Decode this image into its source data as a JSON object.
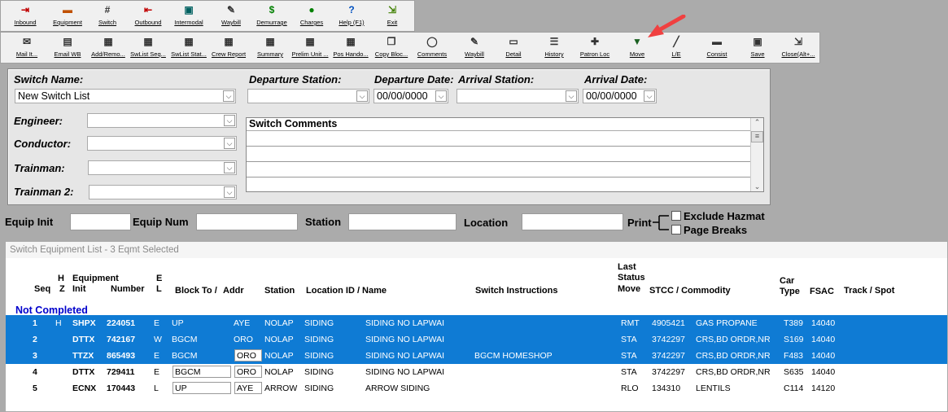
{
  "toolbar1": [
    {
      "label": "Inbound",
      "icon": "inbound-icon",
      "color": "#c00000"
    },
    {
      "label": "Equipment",
      "icon": "railcar-icon",
      "color": "#c05000"
    },
    {
      "label": "Switch",
      "icon": "switch-track-icon",
      "color": "#333333"
    },
    {
      "label": "Outbound",
      "icon": "outbound-icon",
      "color": "#c00000"
    },
    {
      "label": "Intermodal",
      "icon": "intermodal-icon",
      "color": "#006060"
    },
    {
      "label": "Waybill",
      "icon": "waybill-icon",
      "color": "#333333"
    },
    {
      "label": "Demurrage",
      "icon": "dollar-icon",
      "color": "#008000"
    },
    {
      "label": "Charges",
      "icon": "money-bag-icon",
      "color": "#008000"
    },
    {
      "label": "Help (F1)",
      "icon": "help-icon",
      "color": "#0050c0"
    },
    {
      "label": "Exit",
      "icon": "exit-icon",
      "color": "#408000"
    }
  ],
  "toolbar2": [
    {
      "label": "Mail It...",
      "icon": "mail-icon"
    },
    {
      "label": "Email WB",
      "icon": "email-waybill-icon"
    },
    {
      "label": "Add/Remo...",
      "icon": "add-remove-icon"
    },
    {
      "label": "SwList Seq...",
      "icon": "switch-list-sequence-icon"
    },
    {
      "label": "SwList Stat...",
      "icon": "switch-list-status-icon"
    },
    {
      "label": "Crew Report",
      "icon": "crew-report-icon"
    },
    {
      "label": "Summary",
      "icon": "summary-icon"
    },
    {
      "label": "Prelim Unit ...",
      "icon": "prelim-unit-icon"
    },
    {
      "label": "Pos Hando...",
      "icon": "pos-handoff-icon"
    },
    {
      "label": "Copy Bloc...",
      "icon": "copy-block-icon"
    },
    {
      "label": "Comments",
      "icon": "comments-icon"
    },
    {
      "label": "Waybill",
      "icon": "waybill-icon"
    },
    {
      "label": "Detail",
      "icon": "detail-icon"
    },
    {
      "label": "History",
      "icon": "history-icon"
    },
    {
      "label": "Patron Loc",
      "icon": "patron-location-icon"
    },
    {
      "label": "Move",
      "icon": "move-icon"
    },
    {
      "label": "L/E",
      "icon": "load-empty-icon"
    },
    {
      "label": "Consist",
      "icon": "consist-icon"
    },
    {
      "label": "Save",
      "icon": "save-icon"
    },
    {
      "label": "Close(Alt+...",
      "icon": "close-icon"
    }
  ],
  "form": {
    "switch_name_label": "Switch Name:",
    "switch_name_value": "New Switch List",
    "departure_station_label": "Departure Station:",
    "departure_station_value": "",
    "departure_date_label": "Departure Date:",
    "departure_date_value": "00/00/0000",
    "arrival_station_label": "Arrival Station:",
    "arrival_station_value": "",
    "arrival_date_label": "Arrival Date:",
    "arrival_date_value": "00/00/0000",
    "engineer_label": "Engineer:",
    "conductor_label": "Conductor:",
    "trainman_label": "Trainman:",
    "trainman2_label": "Trainman 2:",
    "comments_title": "Switch Comments"
  },
  "filter": {
    "equip_init_label": "Equip Init",
    "equip_num_label": "Equip Num",
    "station_label": "Station",
    "location_label": "Location",
    "print_label": "Print",
    "exclude_hazmat_label": "Exclude Hazmat",
    "page_breaks_label": "Page Breaks"
  },
  "grid": {
    "title": "Switch Equipment List - 3 Eqmt Selected",
    "headers": {
      "seq": "Seq",
      "hz_h": "H",
      "hz_z": "Z",
      "equipment": "Equipment",
      "init": "Init",
      "number": "Number",
      "el_e": "E",
      "el_l": "L",
      "block_to": "Block To /",
      "addr": "Addr",
      "station": "Station",
      "location": "Location ID / Name",
      "instructions": "Switch Instructions",
      "last": "Last",
      "status": "Status",
      "move": "Move",
      "stcc": "STCC / Commodity",
      "car": "Car",
      "type": "Type",
      "fsac": "FSAC",
      "track": "Track / Spot"
    },
    "section_label": "Not Completed",
    "rows": [
      {
        "seq": "1",
        "hz": "H",
        "init": "SHPX",
        "number": "224051",
        "el": "E",
        "block": "UP",
        "addr": "AYE",
        "station": "NOLAP",
        "loc_id": "SIDING",
        "loc_name": "SIDING NO LAPWAI",
        "instr": "",
        "status": "RMT",
        "stcc": "4905421",
        "commodity": "GAS PROPANE",
        "cartype": "T389",
        "fsac": "14040",
        "track": "",
        "selected": true
      },
      {
        "seq": "2",
        "hz": "",
        "init": "DTTX",
        "number": "742167",
        "el": "W",
        "block": "BGCM",
        "addr": "ORO",
        "station": "NOLAP",
        "loc_id": "SIDING",
        "loc_name": "SIDING NO LAPWAI",
        "instr": "",
        "status": "STA",
        "stcc": "3742297",
        "commodity": "CRS,BD ORDR,NR",
        "cartype": "S169",
        "fsac": "14040",
        "track": "",
        "selected": true
      },
      {
        "seq": "3",
        "hz": "",
        "init": "TTZX",
        "number": "865493",
        "el": "E",
        "block": "BGCM",
        "addr": "ORO",
        "station": "NOLAP",
        "loc_id": "SIDING",
        "loc_name": "SIDING NO LAPWAI",
        "instr": "BGCM HOMESHOP",
        "status": "STA",
        "stcc": "3742297",
        "commodity": "CRS,BD ORDR,NR",
        "cartype": "F483",
        "fsac": "14040",
        "track": "",
        "selected": true
      },
      {
        "seq": "4",
        "hz": "",
        "init": "DTTX",
        "number": "729411",
        "el": "E",
        "block": "BGCM",
        "addr": "ORO",
        "station": "NOLAP",
        "loc_id": "SIDING",
        "loc_name": "SIDING NO LAPWAI",
        "instr": "",
        "status": "STA",
        "stcc": "3742297",
        "commodity": "CRS,BD ORDR,NR",
        "cartype": "S635",
        "fsac": "14040",
        "track": "",
        "selected": false
      },
      {
        "seq": "5",
        "hz": "",
        "init": "ECNX",
        "number": "170443",
        "el": "L",
        "block": "UP",
        "addr": "AYE",
        "station": "ARROW",
        "loc_id": "SIDING",
        "loc_name": "ARROW SIDING",
        "instr": "",
        "status": "RLO",
        "stcc": "134310",
        "commodity": "LENTILS",
        "cartype": "C114",
        "fsac": "14120",
        "track": "",
        "selected": false
      }
    ]
  },
  "colors": {
    "selection": "#0f7bd4",
    "section_text": "#0000cc",
    "annotation_arrow": "#f04040"
  }
}
